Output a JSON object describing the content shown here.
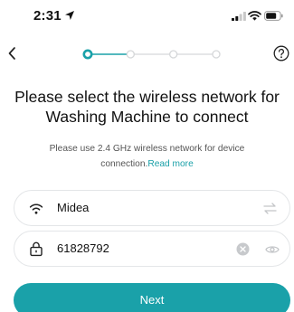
{
  "status_bar": {
    "time": "2:31"
  },
  "stepper": {
    "total_steps": 4,
    "current_step": 1
  },
  "header": {
    "title": "Please select the wireless network for Washing Machine to connect",
    "subtitle": "Please use 2.4 GHz wireless network for device connection.",
    "read_more": "Read more"
  },
  "wifi_field": {
    "value": "Midea"
  },
  "password_field": {
    "value": "61828792"
  },
  "next_button": {
    "label": "Next"
  },
  "colors": {
    "accent": "#1aa1a9",
    "inactive_step": "#d5d7d9"
  },
  "icons": {
    "location": "location-arrow-icon",
    "signal": "cellular-signal-icon",
    "wifi_status": "wifi-icon",
    "battery": "battery-icon",
    "back": "chevron-left-icon",
    "help": "help-circle-icon",
    "wifi_field": "wifi-icon",
    "swap": "swap-arrows-icon",
    "lock": "lock-icon",
    "clear": "clear-icon",
    "eye": "eye-icon"
  }
}
